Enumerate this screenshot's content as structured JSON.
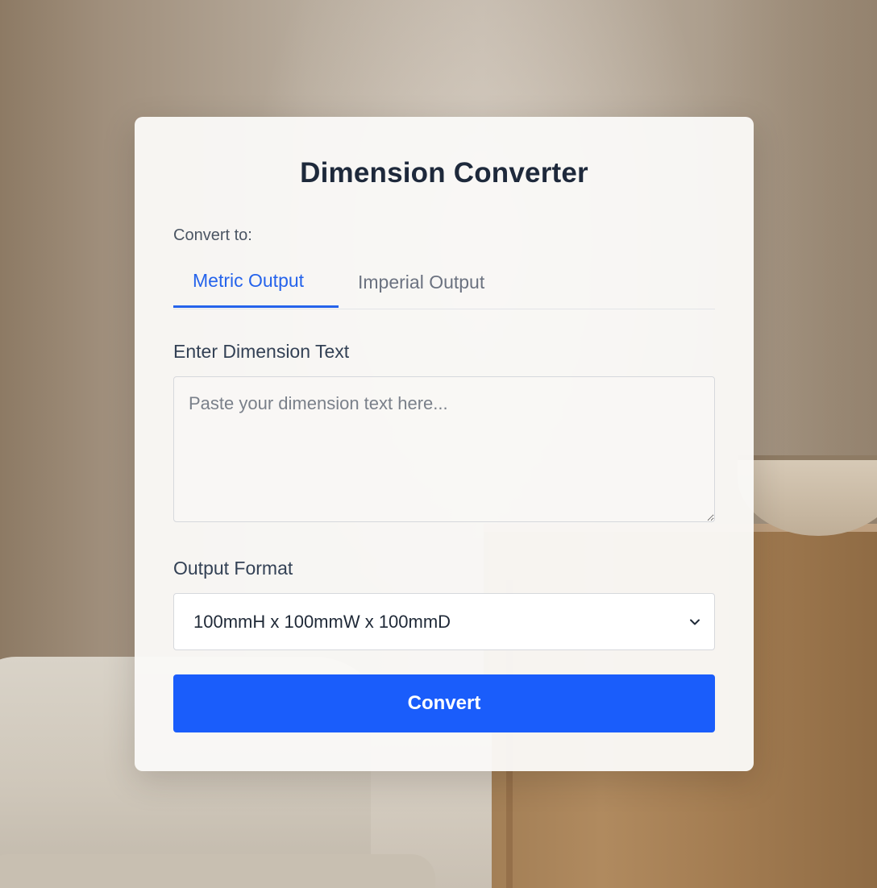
{
  "card": {
    "title": "Dimension Converter",
    "convert_to_label": "Convert to:",
    "tabs": [
      {
        "label": "Metric Output",
        "active": true
      },
      {
        "label": "Imperial Output",
        "active": false
      }
    ],
    "input": {
      "label": "Enter Dimension Text",
      "value": "",
      "placeholder": "Paste your dimension text here..."
    },
    "output_format": {
      "label": "Output Format",
      "selected": "100mmH x 100mmW x 100mmD"
    },
    "convert_button": "Convert"
  },
  "icons": {
    "select_arrow": "chevron-down-icon",
    "resize_handle": "resize-grip-icon"
  },
  "colors": {
    "accent": "#2563eb",
    "button": "#1a5dfb",
    "title": "#1e293b",
    "inactive_tab": "#6b7280"
  }
}
